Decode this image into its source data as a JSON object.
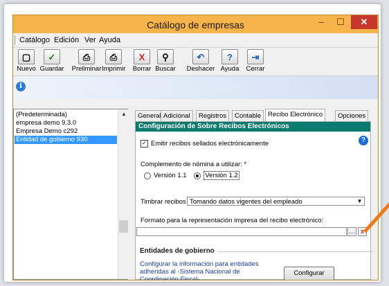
{
  "window": {
    "title": "Catálogo de empresas",
    "minimize_glyph": "–",
    "maximize_glyph": "☐",
    "close_glyph": "✕"
  },
  "menu": {
    "items": [
      "Catálogo",
      "Edición",
      "Ver",
      "Ayuda"
    ]
  },
  "toolbar": {
    "buttons": [
      {
        "label": "Nuevo",
        "icon": "new-document-icon",
        "glyph": "▢"
      },
      {
        "label": "Guardar",
        "icon": "checkmark-icon",
        "glyph": "✓"
      },
      {
        "label": "Preliminar",
        "icon": "print-preview-icon",
        "glyph": "⎙"
      },
      {
        "label": "Imprimir",
        "icon": "printer-icon",
        "glyph": "⎙"
      },
      {
        "label": "Borrar",
        "icon": "delete-x-icon",
        "glyph": "X"
      },
      {
        "label": "Buscar",
        "icon": "binoculars-icon",
        "glyph": "⚲"
      },
      {
        "label": "Deshacer",
        "icon": "undo-icon",
        "glyph": "↶"
      },
      {
        "label": "Ayuda",
        "icon": "help-icon",
        "glyph": "?"
      },
      {
        "label": "Cerrar",
        "icon": "exit-icon",
        "glyph": "⇥"
      }
    ]
  },
  "info_icon_glyph": "i",
  "companies": {
    "items": [
      "(Predeterminada)",
      "empresa demo 9.3.0",
      "Empresa Demo c292",
      "Entidad de gobierno 930"
    ],
    "selected_index": 3
  },
  "tabs": {
    "items": [
      "General",
      "Adicional",
      "Registros",
      "Contable",
      "Recibo Electrónico",
      "Opciones"
    ],
    "active_index": 4
  },
  "panel": {
    "header": "Configuración de Sobre Recibos Electrónicos",
    "help_glyph": "?",
    "emit_checkbox": {
      "label": "Emitir recibos sellados electrónicamente",
      "checked": true,
      "mark": "✓"
    },
    "complement_label": "Complemento de nómina a utilizar: *",
    "radio_options": [
      "Versión 1.1",
      "Versión 1.2"
    ],
    "selected_version_index": 1,
    "timbrar_label": "Timbrar recibos :",
    "timbrar_value": "Tomando datos vigentes del empleado",
    "format_label": "Formato para la representación impresa del recibo electrónico:",
    "format_value": "",
    "browse_glyph": "…",
    "clear_glyph": "x",
    "entities_title": "Entidades de gobierno",
    "entities_text": "Configurar la información para entidades adheridas al -Sistema Nacional de Coordinación Fiscal-",
    "configure_label": "Configurar"
  },
  "colors": {
    "titlebar": "#f6b44a",
    "close_button": "#c7372b",
    "section_header": "#0b7a6e",
    "selection": "#3399ff",
    "link_text": "#1c3f95",
    "annotation_arrow": "#f07a1a"
  }
}
